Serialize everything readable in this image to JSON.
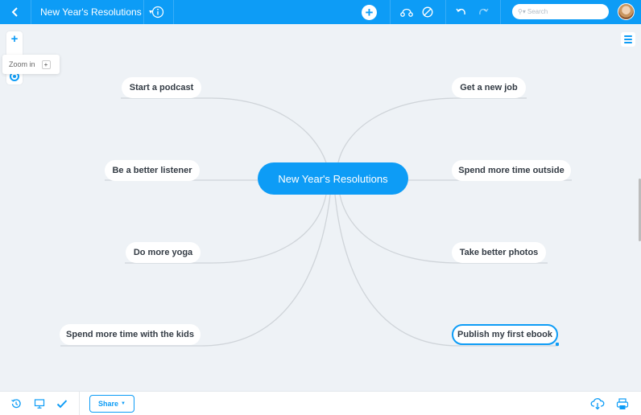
{
  "header": {
    "title": "New Year's Resolutions",
    "search_placeholder": "Search",
    "icons": {
      "back": "chevron-left-icon",
      "info": "info-icon",
      "add": "plus-circle-icon",
      "connect": "connection-icon",
      "disable": "no-entry-icon",
      "undo": "undo-icon",
      "redo": "redo-icon",
      "search": "search-icon",
      "avatar": "user-avatar"
    }
  },
  "zoom": {
    "plus_label": "+",
    "tooltip_label": "Zoom in",
    "tooltip_key": "+"
  },
  "mindmap": {
    "root": "New Year's Resolutions",
    "left_nodes": [
      "Start a podcast",
      "Be a better listener",
      "Do more yoga",
      "Spend more time with the kids"
    ],
    "right_nodes": [
      "Get a new job",
      "Spend more time outside",
      "Take better photos",
      "Publish my first ebook"
    ],
    "selected_node": "Publish my first ebook"
  },
  "footer": {
    "share_label": "Share",
    "icons": {
      "history": "history-icon",
      "present": "monitor-icon",
      "tasks": "checkmark-icon",
      "download": "cloud-download-icon",
      "print": "printer-icon"
    }
  },
  "colors": {
    "accent": "#0d9cf6",
    "canvas": "#eef2f6",
    "link": "#cfd4d9",
    "node_text": "#333b44"
  }
}
